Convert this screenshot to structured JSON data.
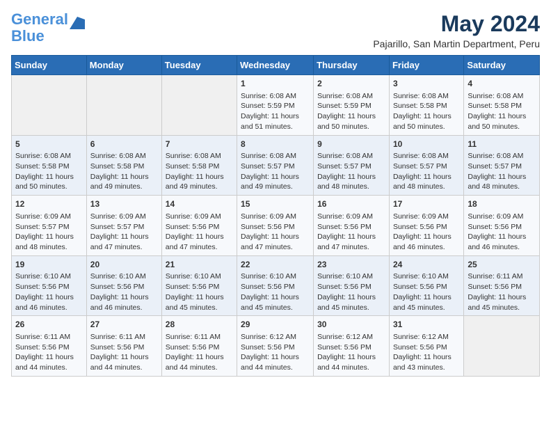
{
  "logo": {
    "line1": "General",
    "line2": "Blue"
  },
  "header": {
    "month_year": "May 2024",
    "location": "Pajarillo, San Martin Department, Peru"
  },
  "weekdays": [
    "Sunday",
    "Monday",
    "Tuesday",
    "Wednesday",
    "Thursday",
    "Friday",
    "Saturday"
  ],
  "weeks": [
    [
      {
        "day": "",
        "data": ""
      },
      {
        "day": "",
        "data": ""
      },
      {
        "day": "",
        "data": ""
      },
      {
        "day": "1",
        "data": "Sunrise: 6:08 AM\nSunset: 5:59 PM\nDaylight: 11 hours\nand 51 minutes."
      },
      {
        "day": "2",
        "data": "Sunrise: 6:08 AM\nSunset: 5:59 PM\nDaylight: 11 hours\nand 50 minutes."
      },
      {
        "day": "3",
        "data": "Sunrise: 6:08 AM\nSunset: 5:58 PM\nDaylight: 11 hours\nand 50 minutes."
      },
      {
        "day": "4",
        "data": "Sunrise: 6:08 AM\nSunset: 5:58 PM\nDaylight: 11 hours\nand 50 minutes."
      }
    ],
    [
      {
        "day": "5",
        "data": "Sunrise: 6:08 AM\nSunset: 5:58 PM\nDaylight: 11 hours\nand 50 minutes."
      },
      {
        "day": "6",
        "data": "Sunrise: 6:08 AM\nSunset: 5:58 PM\nDaylight: 11 hours\nand 49 minutes."
      },
      {
        "day": "7",
        "data": "Sunrise: 6:08 AM\nSunset: 5:58 PM\nDaylight: 11 hours\nand 49 minutes."
      },
      {
        "day": "8",
        "data": "Sunrise: 6:08 AM\nSunset: 5:57 PM\nDaylight: 11 hours\nand 49 minutes."
      },
      {
        "day": "9",
        "data": "Sunrise: 6:08 AM\nSunset: 5:57 PM\nDaylight: 11 hours\nand 48 minutes."
      },
      {
        "day": "10",
        "data": "Sunrise: 6:08 AM\nSunset: 5:57 PM\nDaylight: 11 hours\nand 48 minutes."
      },
      {
        "day": "11",
        "data": "Sunrise: 6:08 AM\nSunset: 5:57 PM\nDaylight: 11 hours\nand 48 minutes."
      }
    ],
    [
      {
        "day": "12",
        "data": "Sunrise: 6:09 AM\nSunset: 5:57 PM\nDaylight: 11 hours\nand 48 minutes."
      },
      {
        "day": "13",
        "data": "Sunrise: 6:09 AM\nSunset: 5:57 PM\nDaylight: 11 hours\nand 47 minutes."
      },
      {
        "day": "14",
        "data": "Sunrise: 6:09 AM\nSunset: 5:56 PM\nDaylight: 11 hours\nand 47 minutes."
      },
      {
        "day": "15",
        "data": "Sunrise: 6:09 AM\nSunset: 5:56 PM\nDaylight: 11 hours\nand 47 minutes."
      },
      {
        "day": "16",
        "data": "Sunrise: 6:09 AM\nSunset: 5:56 PM\nDaylight: 11 hours\nand 47 minutes."
      },
      {
        "day": "17",
        "data": "Sunrise: 6:09 AM\nSunset: 5:56 PM\nDaylight: 11 hours\nand 46 minutes."
      },
      {
        "day": "18",
        "data": "Sunrise: 6:09 AM\nSunset: 5:56 PM\nDaylight: 11 hours\nand 46 minutes."
      }
    ],
    [
      {
        "day": "19",
        "data": "Sunrise: 6:10 AM\nSunset: 5:56 PM\nDaylight: 11 hours\nand 46 minutes."
      },
      {
        "day": "20",
        "data": "Sunrise: 6:10 AM\nSunset: 5:56 PM\nDaylight: 11 hours\nand 46 minutes."
      },
      {
        "day": "21",
        "data": "Sunrise: 6:10 AM\nSunset: 5:56 PM\nDaylight: 11 hours\nand 45 minutes."
      },
      {
        "day": "22",
        "data": "Sunrise: 6:10 AM\nSunset: 5:56 PM\nDaylight: 11 hours\nand 45 minutes."
      },
      {
        "day": "23",
        "data": "Sunrise: 6:10 AM\nSunset: 5:56 PM\nDaylight: 11 hours\nand 45 minutes."
      },
      {
        "day": "24",
        "data": "Sunrise: 6:10 AM\nSunset: 5:56 PM\nDaylight: 11 hours\nand 45 minutes."
      },
      {
        "day": "25",
        "data": "Sunrise: 6:11 AM\nSunset: 5:56 PM\nDaylight: 11 hours\nand 45 minutes."
      }
    ],
    [
      {
        "day": "26",
        "data": "Sunrise: 6:11 AM\nSunset: 5:56 PM\nDaylight: 11 hours\nand 44 minutes."
      },
      {
        "day": "27",
        "data": "Sunrise: 6:11 AM\nSunset: 5:56 PM\nDaylight: 11 hours\nand 44 minutes."
      },
      {
        "day": "28",
        "data": "Sunrise: 6:11 AM\nSunset: 5:56 PM\nDaylight: 11 hours\nand 44 minutes."
      },
      {
        "day": "29",
        "data": "Sunrise: 6:12 AM\nSunset: 5:56 PM\nDaylight: 11 hours\nand 44 minutes."
      },
      {
        "day": "30",
        "data": "Sunrise: 6:12 AM\nSunset: 5:56 PM\nDaylight: 11 hours\nand 44 minutes."
      },
      {
        "day": "31",
        "data": "Sunrise: 6:12 AM\nSunset: 5:56 PM\nDaylight: 11 hours\nand 43 minutes."
      },
      {
        "day": "",
        "data": ""
      }
    ]
  ]
}
